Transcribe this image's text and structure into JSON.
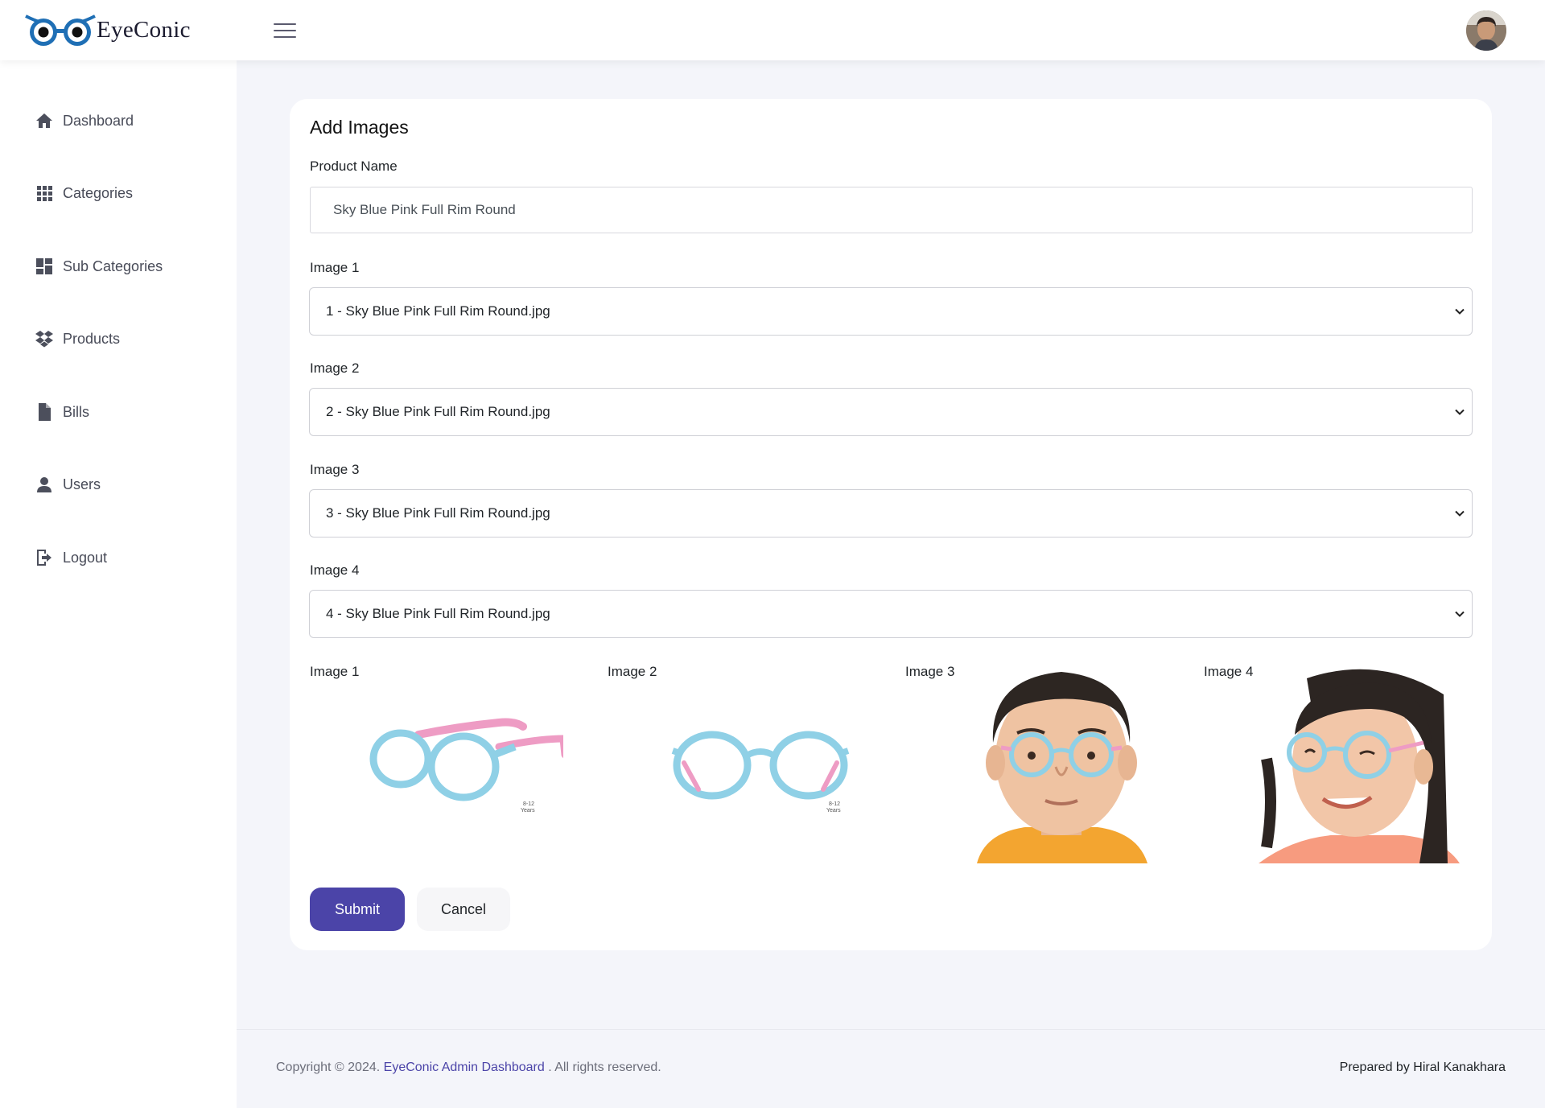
{
  "brand": {
    "name": "EyeConic",
    "logo_icon": "owl-eyes-logo"
  },
  "header": {
    "menu_icon": "hamburger-icon",
    "avatar": "user-avatar"
  },
  "sidebar": {
    "items": [
      {
        "label": "Dashboard",
        "icon": "home-icon"
      },
      {
        "label": "Categories",
        "icon": "grid-icon"
      },
      {
        "label": "Sub Categories",
        "icon": "dashboard-icon"
      },
      {
        "label": "Products",
        "icon": "dropbox-icon"
      },
      {
        "label": "Bills",
        "icon": "file-icon"
      },
      {
        "label": "Users",
        "icon": "user-icon"
      },
      {
        "label": "Logout",
        "icon": "logout-icon"
      }
    ]
  },
  "form": {
    "title": "Add Images",
    "product_name_label": "Product Name",
    "product_name_value": "Sky Blue Pink Full Rim Round",
    "selects": [
      {
        "label": "Image 1",
        "value": "1 - Sky Blue Pink Full Rim Round.jpg"
      },
      {
        "label": "Image 2",
        "value": "2 - Sky Blue Pink Full Rim Round.jpg"
      },
      {
        "label": "Image 3",
        "value": "3 - Sky Blue Pink Full Rim Round.jpg"
      },
      {
        "label": "Image 4",
        "value": "4 - Sky Blue Pink Full Rim Round.jpg"
      }
    ],
    "previews": [
      {
        "label": "Image 1"
      },
      {
        "label": "Image 2"
      },
      {
        "label": "Image 3"
      },
      {
        "label": "Image 4"
      }
    ],
    "submit_label": "Submit",
    "cancel_label": "Cancel"
  },
  "footer": {
    "copyright_prefix": "Copyright © 2024.",
    "link_text": "EyeConic Admin Dashboard",
    "copyright_suffix": ". All rights reserved.",
    "prepared_by": "Prepared by Hiral Kanakhara"
  },
  "colors": {
    "accent": "#4b44a8",
    "background": "#f4f5fa",
    "frame_blue": "#8fd0e6",
    "frame_pink": "#ee9cc4"
  }
}
